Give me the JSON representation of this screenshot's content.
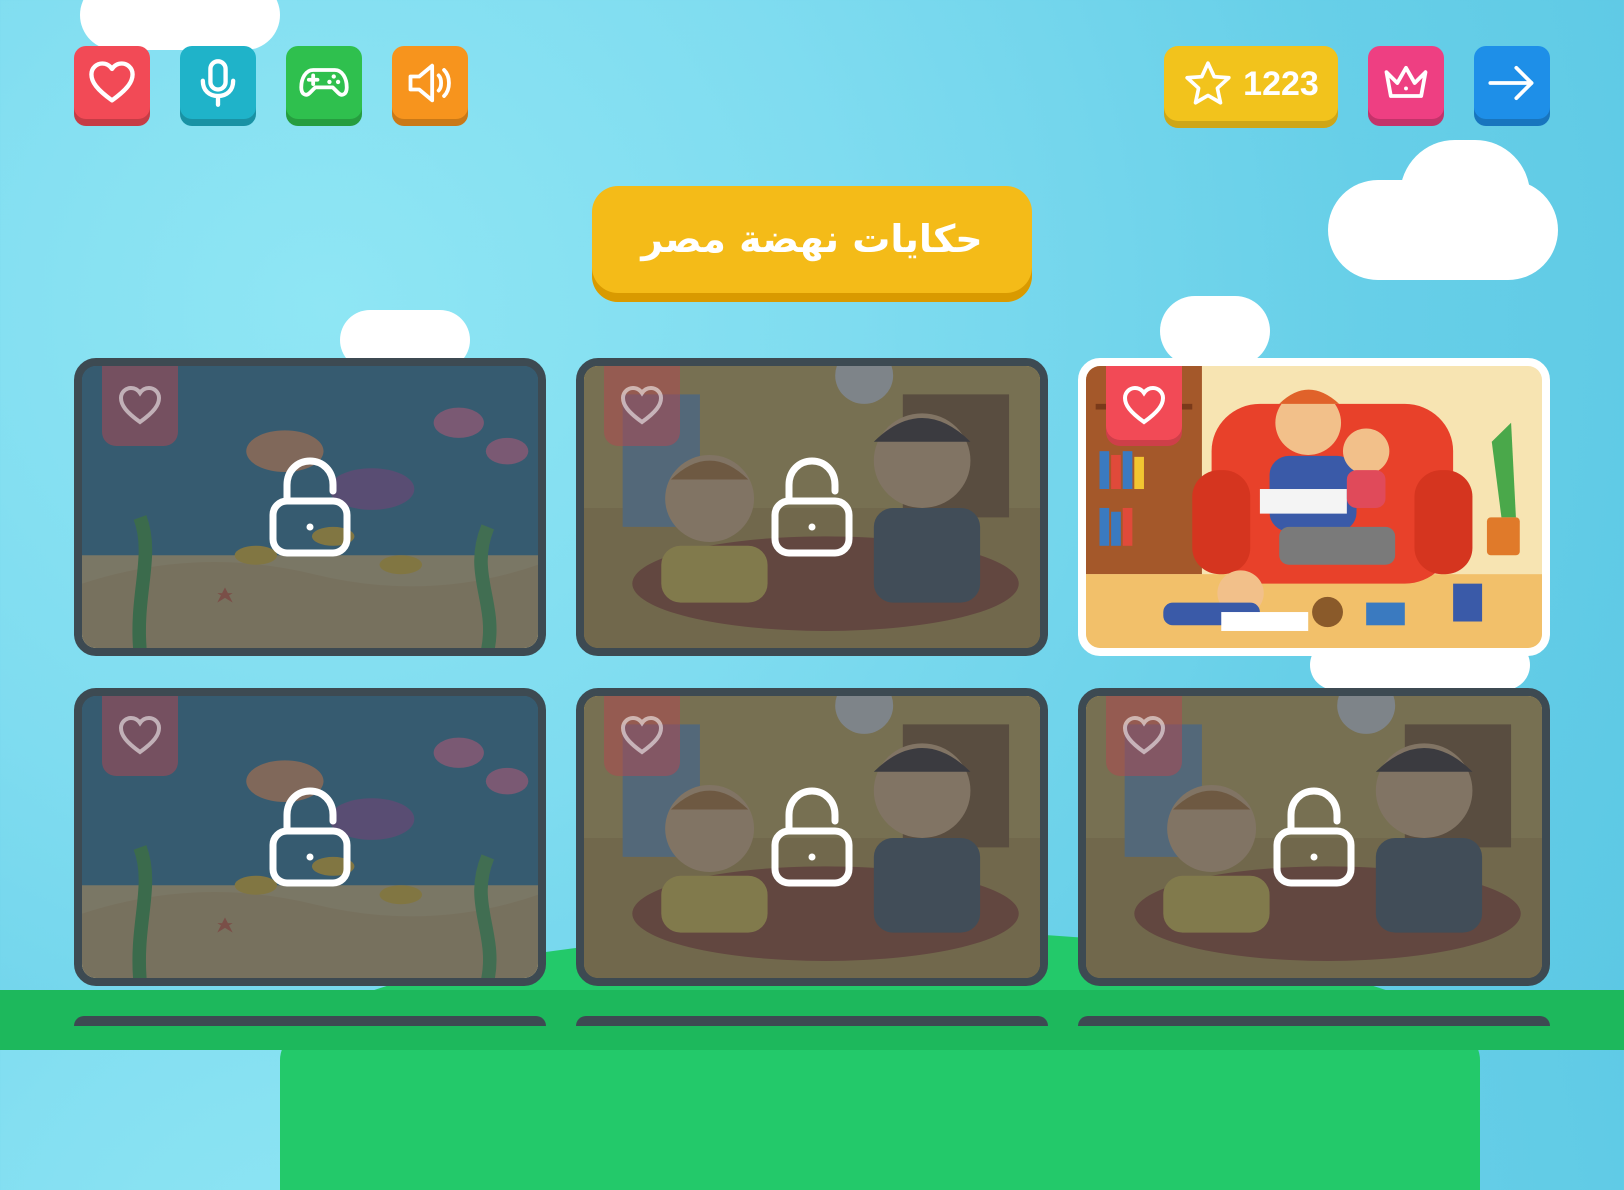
{
  "header": {
    "title": "حكايات نهضة مصر",
    "score": "1223",
    "left_buttons": [
      {
        "name": "favorites-button",
        "icon": "heart-icon",
        "color": "#f24a56"
      },
      {
        "name": "microphone-button",
        "icon": "microphone-icon",
        "color": "#1fb3c9"
      },
      {
        "name": "games-button",
        "icon": "gamepad-icon",
        "color": "#2fc04e"
      },
      {
        "name": "sound-button",
        "icon": "speaker-icon",
        "color": "#f7941d"
      }
    ],
    "right_buttons": [
      {
        "name": "premium-button",
        "icon": "crown-icon",
        "color": "#ee3f82"
      },
      {
        "name": "exit-button",
        "icon": "arrow-right-icon",
        "color": "#1e8fe8"
      }
    ],
    "score_color": "#f2c31c",
    "score_icon": "star-icon"
  },
  "stories": [
    {
      "scene": "underwater-divers",
      "locked": true,
      "favorite_icon": "heart-icon",
      "lock_icon": "lock-icon"
    },
    {
      "scene": "boys-playing-ball",
      "locked": true,
      "favorite_icon": "heart-icon",
      "lock_icon": "lock-icon"
    },
    {
      "scene": "family-reading-sofa",
      "locked": false,
      "favorite_icon": "heart-icon"
    },
    {
      "scene": "underwater-divers",
      "locked": true,
      "favorite_icon": "heart-icon",
      "lock_icon": "lock-icon"
    },
    {
      "scene": "boys-playing-ball",
      "locked": true,
      "favorite_icon": "heart-icon",
      "lock_icon": "lock-icon"
    },
    {
      "scene": "boys-playing-ball",
      "locked": true,
      "favorite_icon": "heart-icon",
      "lock_icon": "lock-icon"
    }
  ]
}
